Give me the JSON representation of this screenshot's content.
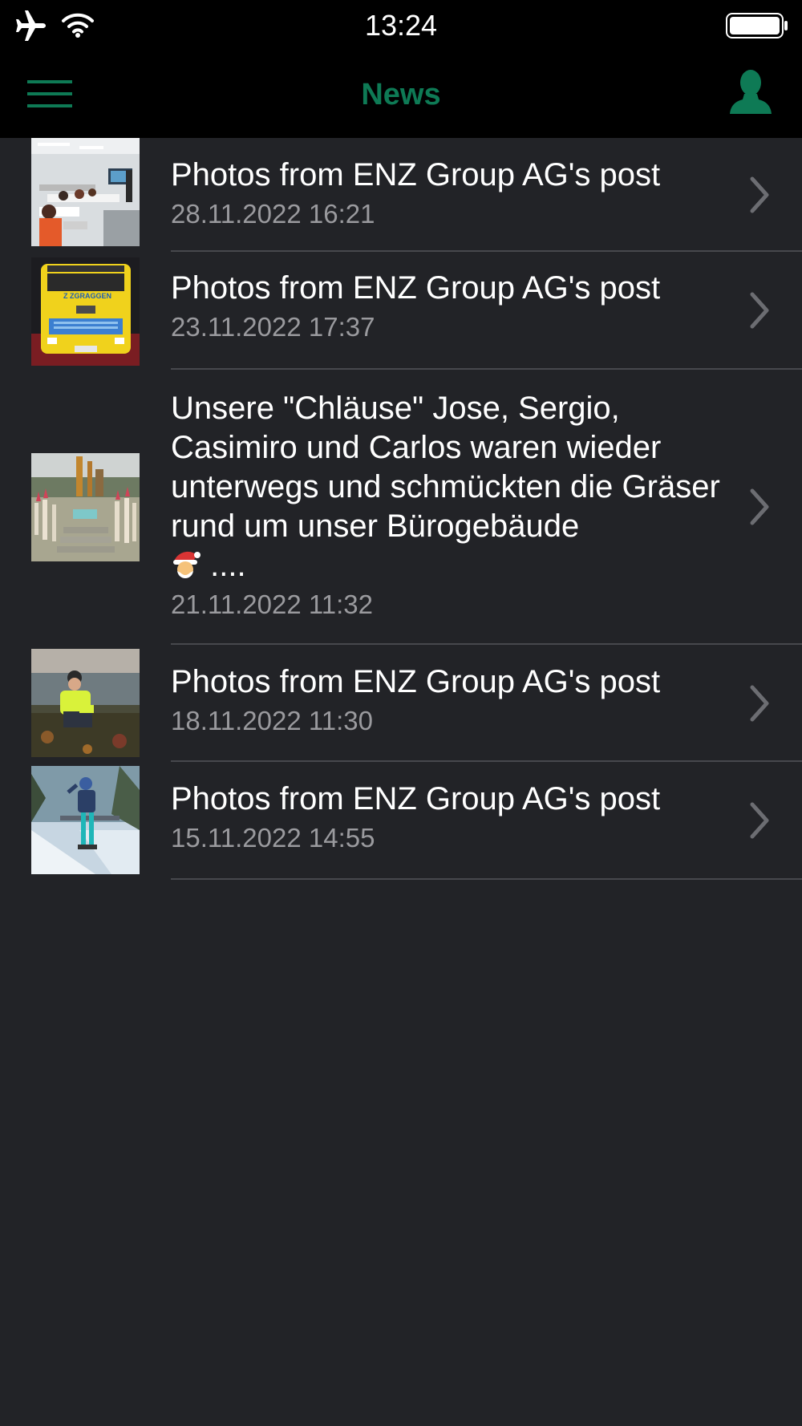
{
  "status_bar": {
    "time": "13:24",
    "icons": [
      "airplane-icon",
      "wifi-icon",
      "battery-icon"
    ]
  },
  "nav": {
    "title": "News",
    "left_icon": "hamburger-menu-icon",
    "right_icon": "user-profile-icon"
  },
  "colors": {
    "accent": "#0e7a55",
    "background": "#222327",
    "bar": "#000000",
    "secondary_text": "#9a9a9e",
    "divider": "#47484d"
  },
  "news": [
    {
      "title": "Photos from ENZ Group AG's post",
      "date": "28.11.2022 16:21",
      "thumbnail": "classroom-photo"
    },
    {
      "title": "Photos from ENZ Group AG's post",
      "date": "23.11.2022 17:37",
      "thumbnail": "yellow-truck-photo"
    },
    {
      "title": "Unsere \"Chläuse\" Jose, Sergio, Casimiro und Carlos waren wieder unterwegs und schmückten die Gräser rund um unser Bürogebäude",
      "title_suffix": " ....",
      "emoji": "santa-emoji",
      "date": "21.11.2022 11:32",
      "thumbnail": "decorated-grasses-photo"
    },
    {
      "title": "Photos from ENZ Group AG's post",
      "date": "18.11.2022 11:30",
      "thumbnail": "worker-planting-photo"
    },
    {
      "title": "Photos from ENZ Group AG's post",
      "date": "15.11.2022 14:55",
      "thumbnail": "skier-snow-photo"
    }
  ]
}
